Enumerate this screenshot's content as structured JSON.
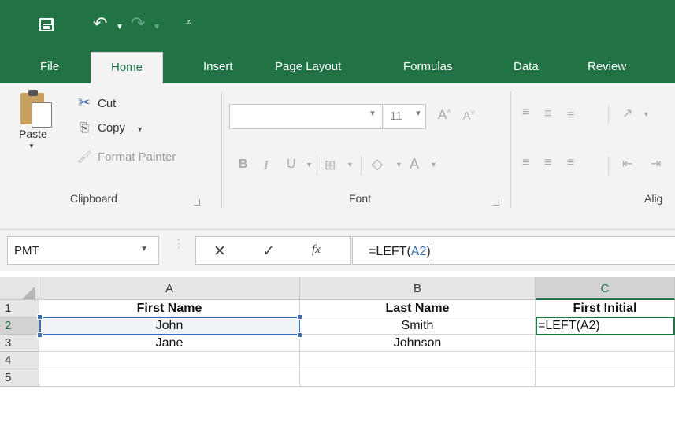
{
  "qat": {
    "save_icon": "save-icon",
    "undo_icon": "undo-icon",
    "redo_icon": "redo-icon",
    "customize_icon": "customize-toolbar-icon"
  },
  "tabs": [
    {
      "label": "File"
    },
    {
      "label": "Home"
    },
    {
      "label": "Insert"
    },
    {
      "label": "Page Layout"
    },
    {
      "label": "Formulas"
    },
    {
      "label": "Data"
    },
    {
      "label": "Review"
    }
  ],
  "active_tab": "Home",
  "ribbon": {
    "clipboard": {
      "paste_label": "Paste",
      "cut_label": "Cut",
      "copy_label": "Copy",
      "format_painter_label": "Format Painter",
      "group_label": "Clipboard"
    },
    "font": {
      "font_name": "",
      "font_size": "11",
      "bold": "B",
      "italic": "I",
      "underline": "U",
      "font_color": "A",
      "grow": "A",
      "shrink": "A",
      "group_label": "Font"
    },
    "alignment": {
      "group_label": "Alig"
    }
  },
  "formula_bar": {
    "name_box": "PMT",
    "fx_label": "fx",
    "formula_prefix": "=LEFT(",
    "formula_ref": "A2",
    "formula_suffix": ")"
  },
  "sheet": {
    "column_headers": [
      "A",
      "B",
      "C"
    ],
    "row_headers": [
      "1",
      "2",
      "3",
      "4",
      "5"
    ],
    "rows": [
      [
        "First Name",
        "Last Name",
        "First Initial"
      ],
      [
        "John",
        "Smith",
        "=LEFT(A2)"
      ],
      [
        "Jane",
        "Johnson",
        ""
      ],
      [
        "",
        "",
        ""
      ],
      [
        "",
        "",
        ""
      ]
    ]
  },
  "colors": {
    "brand": "#217346",
    "reference": "#3a6fb3"
  }
}
